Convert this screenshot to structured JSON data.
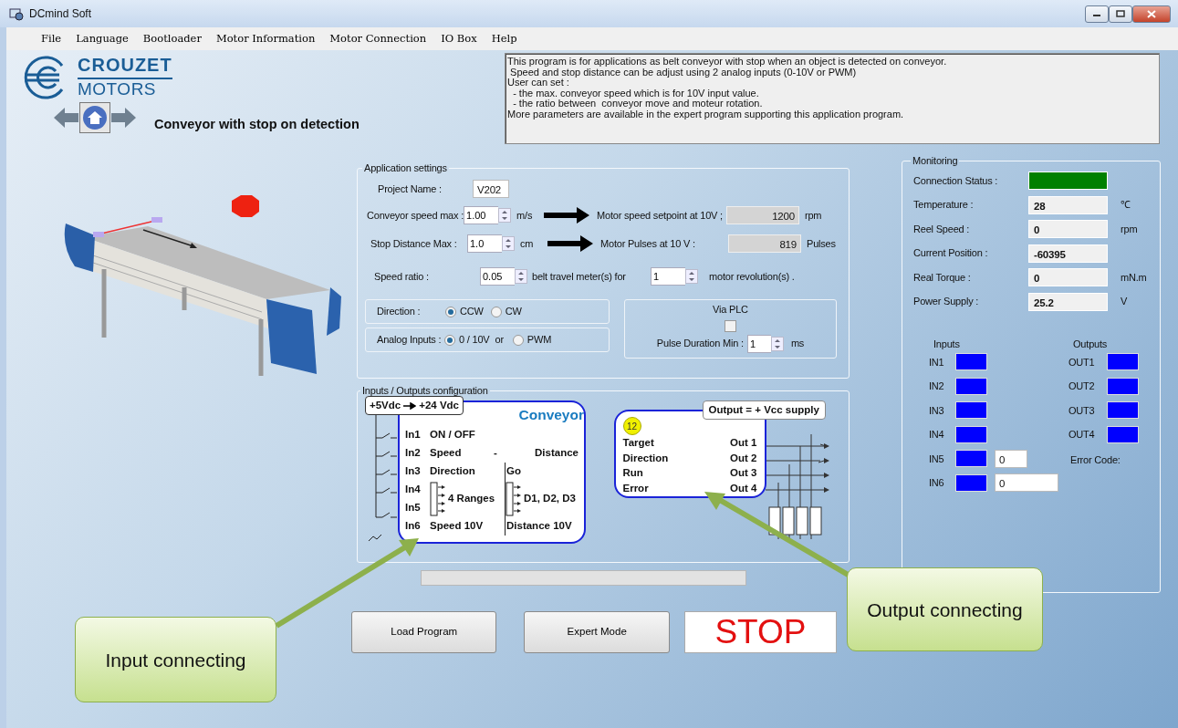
{
  "window": {
    "title": "DCmind Soft"
  },
  "menu": [
    "File",
    "Language",
    "Bootloader",
    "Motor Information",
    "Motor Connection",
    "IO Box",
    "Help"
  ],
  "header": {
    "brand_top": "CROUZET",
    "brand_bottom": "MOTORS",
    "title": "Conveyor with stop on detection"
  },
  "description": "This program is for applications as belt conveyor with stop when an object is detected on conveyor.\n Speed and stop distance can be adjust using 2 analog inputs (0-10V or PWM)\nUser can set :\n  - the max. conveyor speed which is for 10V input value.\n  - the ratio between  conveyor move and moteur rotation.\nMore parameters are available in the expert program supporting this application program.",
  "app_settings": {
    "title": "Application settings",
    "project": {
      "label": "Project Name :",
      "value": "V202"
    },
    "speed": {
      "label": "Conveyor speed max :",
      "value": "1.00",
      "unit": "m/s",
      "result_label": "Motor speed setpoint at 10V ;",
      "result": "1200",
      "result_unit": "rpm"
    },
    "distance": {
      "label": "Stop Distance Max :",
      "value": "1.0",
      "unit": "cm",
      "result_label": "Motor Pulses at 10 V :",
      "result": "819",
      "result_unit": "Pulses"
    },
    "ratio": {
      "label": "Speed ratio :",
      "value": "0.05",
      "middle": "belt travel meter(s) for",
      "value2": "1",
      "end": "motor revolution(s) ."
    },
    "direction": {
      "label": "Direction :",
      "options": [
        {
          "label": "CCW",
          "selected": true
        },
        {
          "label": "CW",
          "selected": false
        }
      ]
    },
    "analog": {
      "label": "Analog Inputs :",
      "joiner": "or",
      "options": [
        {
          "label": "0 / 10V",
          "selected": true
        },
        {
          "label": "PWM",
          "selected": false
        }
      ]
    },
    "plc": {
      "label": "Via PLC",
      "checked": false,
      "pulse_label": "Pulse Duration Min :",
      "pulse_value": "1",
      "pulse_unit": "ms"
    }
  },
  "io_config": {
    "title": "Inputs / Outputs configuration",
    "supply_from": "+5Vdc",
    "supply_to": "+24 Vdc",
    "device": "Conveyor",
    "inputs": [
      {
        "kind": "single",
        "pins": [
          "In1"
        ],
        "left": "ON / OFF"
      },
      {
        "kind": "split",
        "pins": [
          "In2"
        ],
        "left": "Speed",
        "sep": "-",
        "right": "Distance"
      },
      {
        "kind": "divided",
        "pins": [
          "In3"
        ],
        "left": "Direction",
        "right": "Go"
      },
      {
        "kind": "range",
        "pins": [
          "In4",
          "In5"
        ],
        "left": "4 Ranges",
        "right": "D1, D2, D3"
      },
      {
        "kind": "divided",
        "pins": [
          "In6"
        ],
        "left": "Speed 10V",
        "right": "Distance 10V"
      }
    ],
    "outputs": {
      "badge": "12",
      "header": "Output = + Vcc supply",
      "rows": [
        {
          "signal": "Target",
          "pin": "Out 1"
        },
        {
          "signal": "Direction",
          "pin": "Out 2"
        },
        {
          "signal": "Run",
          "pin": "Out 3"
        },
        {
          "signal": "Error",
          "pin": "Out 4"
        }
      ]
    }
  },
  "progress": {
    "level": 0
  },
  "buttons": [
    {
      "label": "Load Program",
      "kind": "normal"
    },
    {
      "label": "Expert Mode",
      "kind": "normal"
    },
    {
      "label": "STOP",
      "kind": "stop"
    }
  ],
  "monitoring": {
    "title": "Monitoring",
    "connection": {
      "label": "Connection Status :",
      "color": "#008000"
    },
    "readings": [
      {
        "label": "Temperature :",
        "value": "28",
        "unit": "℃"
      },
      {
        "label": "Reel Speed :",
        "value": "0",
        "unit": "rpm"
      },
      {
        "label": "Current Position :",
        "value": "-60395"
      },
      {
        "label": "Real Torque :",
        "value": "0",
        "unit": "mN.m"
      },
      {
        "label": "Power Supply :",
        "value": "25.2",
        "unit": "V"
      }
    ],
    "inputs_title": "Inputs",
    "outputs_title": "Outputs",
    "inputs": [
      {
        "label": "IN1",
        "color": "#0000ff"
      },
      {
        "label": "IN2",
        "color": "#0000ff"
      },
      {
        "label": "IN3",
        "color": "#0000ff"
      },
      {
        "label": "IN4",
        "color": "#0000ff"
      },
      {
        "label": "IN5",
        "color": "#0000ff",
        "value": "0"
      },
      {
        "label": "IN6",
        "color": "#0000ff",
        "value": "0"
      }
    ],
    "outputs": [
      {
        "label": "OUT1",
        "color": "#0000ff"
      },
      {
        "label": "OUT2",
        "color": "#0000ff"
      },
      {
        "label": "OUT3",
        "color": "#0000ff"
      },
      {
        "label": "OUT4",
        "color": "#0000ff"
      }
    ],
    "error_label": "Error Code:"
  },
  "callouts": [
    {
      "kind": "input",
      "text": "Input connecting"
    },
    {
      "kind": "output",
      "text": "Output connecting"
    }
  ]
}
